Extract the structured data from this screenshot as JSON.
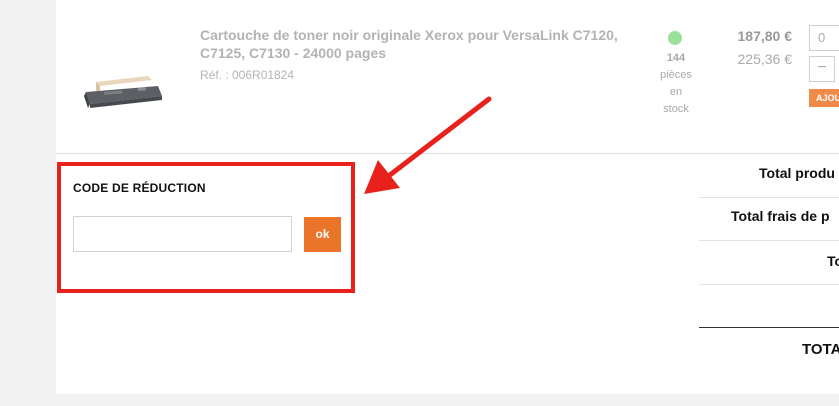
{
  "product": {
    "title": "Cartouche de toner noir originale Xerox pour VersaLink C7120, C7125, C7130 - 24000 pages",
    "reference": "Réf. : 006R01824",
    "image_icon": "toner-cartridge-image",
    "stock": {
      "quantity": "144",
      "line1": "pièces",
      "line2": "en",
      "line3": "stock",
      "status_color": "#9be19b"
    },
    "price_excl": "187,80 €",
    "price_incl": "225,36 €",
    "qty_value": "0",
    "minus_label": "−",
    "add_button": "AJOU"
  },
  "discount": {
    "title": "CODE DE RÉDUCTION",
    "input_value": "",
    "submit_label": "ok"
  },
  "totals": {
    "products_label": "Total produ",
    "shipping_label": "Total frais de p",
    "tax_label": "To",
    "grand_total_label": "TOTA"
  },
  "annotation": {
    "arrow_color": "#e8211d",
    "box_color": "#e8211d"
  },
  "colors": {
    "accent": "#ea7429",
    "page_bg": "#f2f2f2"
  }
}
